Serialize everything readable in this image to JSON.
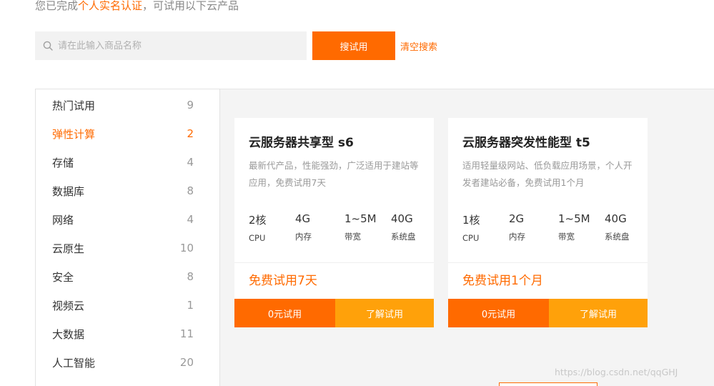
{
  "notice": {
    "prefix": "您已完成",
    "highlight": "个人实名认证",
    "suffix": "，可试用以下云产品"
  },
  "search": {
    "placeholder": "请在此输入商品名称",
    "value": "",
    "button_label": "搜试用",
    "clear_label": "清空搜索",
    "icon": "search-icon"
  },
  "sidebar": {
    "items": [
      {
        "label": "热门试用",
        "count": "9",
        "active": false
      },
      {
        "label": "弹性计算",
        "count": "2",
        "active": true
      },
      {
        "label": "存储",
        "count": "4",
        "active": false
      },
      {
        "label": "数据库",
        "count": "8",
        "active": false
      },
      {
        "label": "网络",
        "count": "4",
        "active": false
      },
      {
        "label": "云原生",
        "count": "10",
        "active": false
      },
      {
        "label": "安全",
        "count": "8",
        "active": false
      },
      {
        "label": "视频云",
        "count": "1",
        "active": false
      },
      {
        "label": "大数据",
        "count": "11",
        "active": false
      },
      {
        "label": "人工智能",
        "count": "20",
        "active": false
      }
    ]
  },
  "cards": [
    {
      "title": "云服务器共享型 s6",
      "description": "最新代产品，性能强劲，广泛适用于建站等应用，免费试用7天",
      "specs": [
        {
          "value": "2核",
          "label": "CPU"
        },
        {
          "value": "4G",
          "label": "内存"
        },
        {
          "value": "1~5M",
          "label": "带宽"
        },
        {
          "value": "40G",
          "label": "系统盘"
        }
      ],
      "price": "免费试用7天",
      "btn_free": "0元试用",
      "btn_info": "了解试用"
    },
    {
      "title": "云服务器突发性能型 t5",
      "description": "适用轻量级网站、低负载应用场景，个人开发者建站必备，免费试用1个月",
      "specs": [
        {
          "value": "1核",
          "label": "CPU"
        },
        {
          "value": "2G",
          "label": "内存"
        },
        {
          "value": "1~5M",
          "label": "带宽"
        },
        {
          "value": "40G",
          "label": "系统盘"
        }
      ],
      "price": "免费试用1个月",
      "btn_free": "0元试用",
      "btn_info": "了解试用"
    }
  ],
  "watermark": "https://blog.csdn.net/qqGHJ",
  "colors": {
    "accent": "#ff6a00",
    "accent_light": "#ffa10a",
    "muted_text": "#999999",
    "panel_bg": "#f4f4f4"
  }
}
